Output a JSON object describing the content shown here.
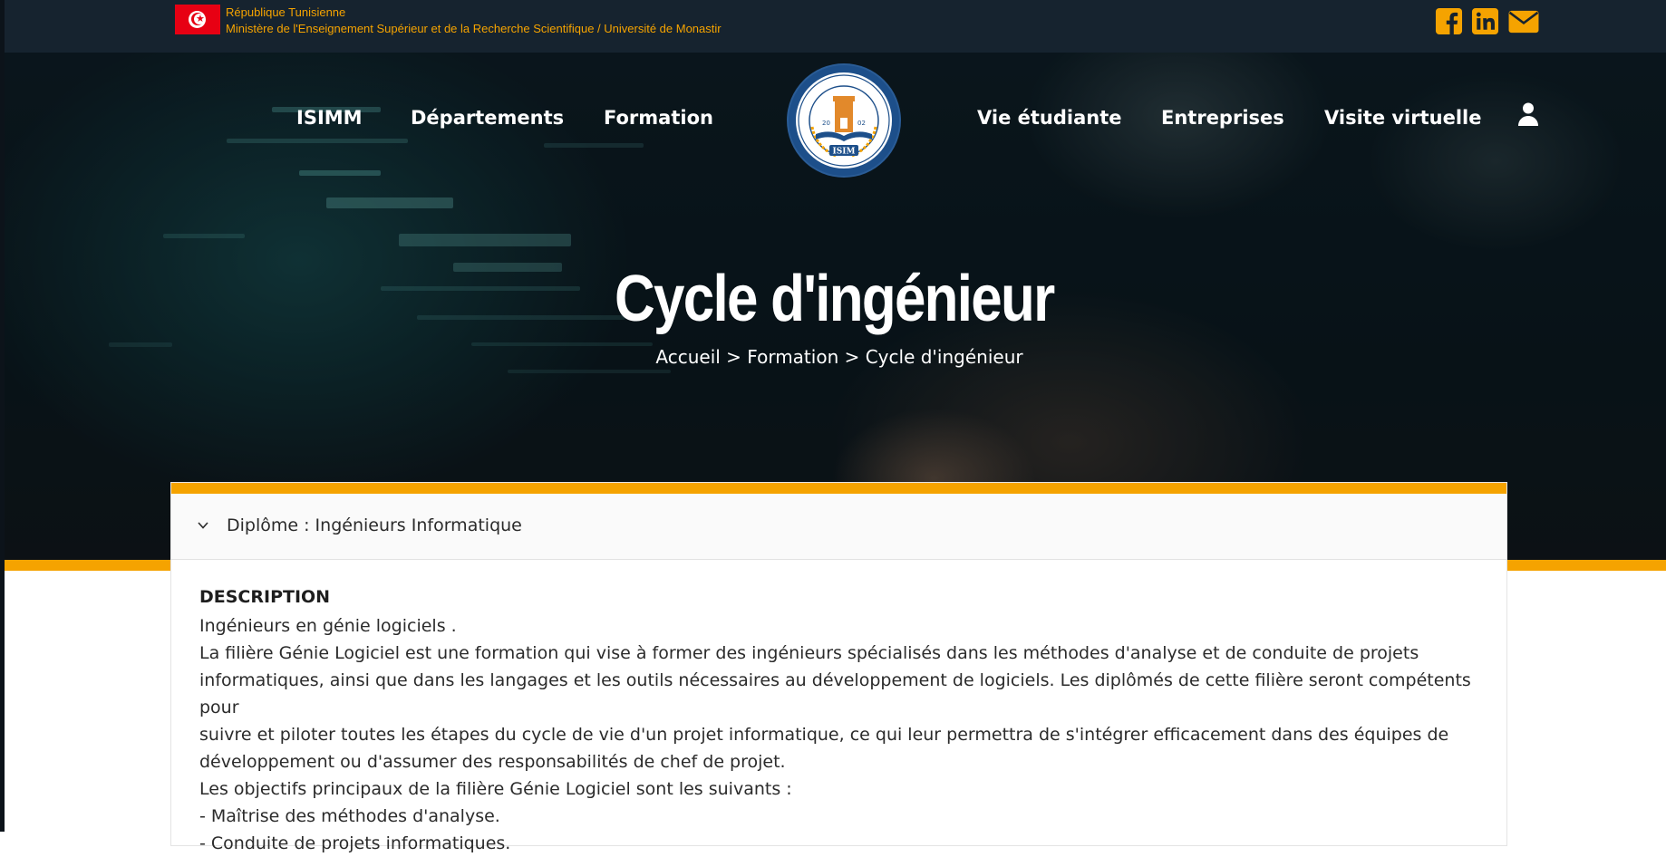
{
  "topbar": {
    "gov_line1": "République Tunisienne",
    "gov_line2": "Ministère de l'Enseignement Supérieur et de la Recherche Scientifique / Université de Monastir",
    "social_icons": [
      "facebook-icon",
      "linkedin-icon",
      "envelope-icon"
    ],
    "accent_color": "#f5a300"
  },
  "nav": {
    "items": [
      "ISIMM",
      "Départements",
      "Formation",
      "Vie étudiante",
      "Entreprises",
      "Visite virtuelle"
    ],
    "logo_text": "ISIM",
    "logo_year": [
      "20",
      "02"
    ],
    "user_icon": "user-icon"
  },
  "hero": {
    "title": "Cycle d'ingénieur",
    "breadcrumb": "Accueil > Formation > Cycle d'ingénieur"
  },
  "accordion": {
    "title": "Diplôme : Ingénieurs Informatique",
    "chevron_icon": "chevron-down-icon"
  },
  "content": {
    "heading": "DESCRIPTION",
    "lines": [
      "Ingénieurs en génie logiciels .",
      "La filière Génie Logiciel est une formation qui vise à former des ingénieurs spécialisés dans les méthodes d'analyse et de conduite de projets",
      "informatiques, ainsi que dans les langages et les outils nécessaires au développement de logiciels. Les diplômés de cette filière seront compétents pour",
      "suivre et piloter toutes les étapes du cycle de vie d'un projet informatique, ce qui leur permettra de s'intégrer efficacement dans des équipes de",
      "développement ou d'assumer des responsabilités de chef de projet.",
      "Les objectifs principaux de la filière Génie Logiciel sont les suivants :",
      "- Maîtrise des méthodes d'analyse.",
      "- Conduite de projets informatiques."
    ]
  },
  "colors": {
    "topbar_bg": "#16232f",
    "brand_orange": "#f5a300",
    "logo_blue": "#1d4f8a"
  }
}
